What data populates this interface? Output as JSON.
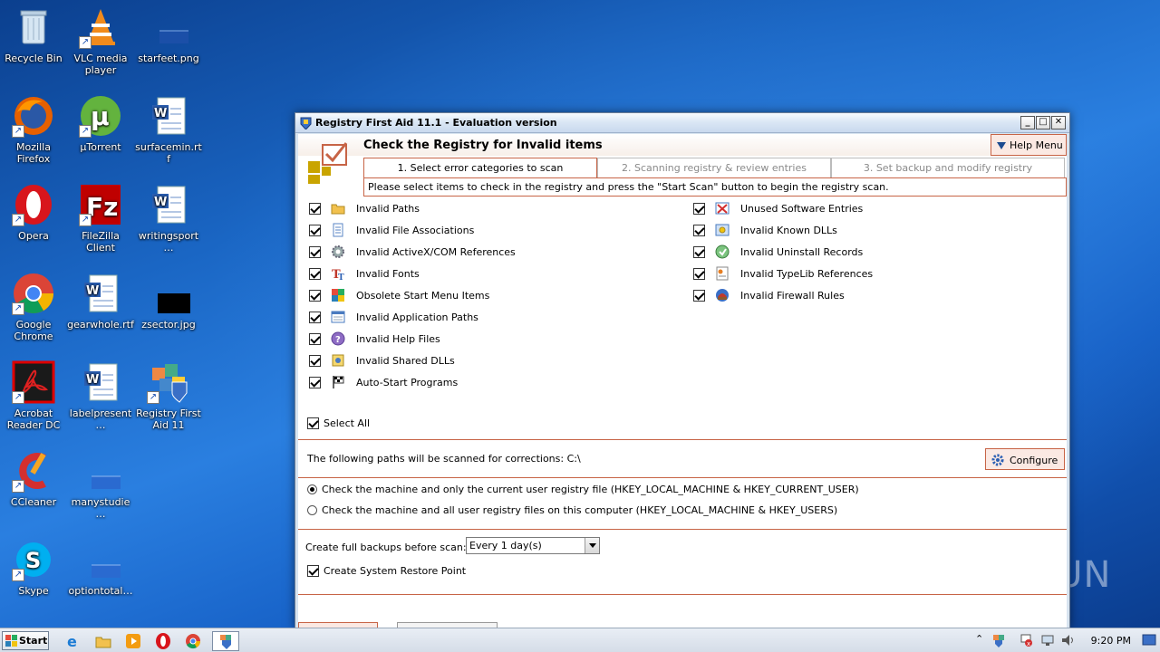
{
  "desktop": {
    "icons": [
      {
        "label": "Recycle Bin"
      },
      {
        "label": "VLC media player"
      },
      {
        "label": "starfeet.png"
      },
      {
        "label": "Mozilla Firefox"
      },
      {
        "label": "µTorrent"
      },
      {
        "label": "surfacemin.rtf"
      },
      {
        "label": "Opera"
      },
      {
        "label": "FileZilla Client"
      },
      {
        "label": "writingsport…"
      },
      {
        "label": "Google Chrome"
      },
      {
        "label": "gearwhole.rtf"
      },
      {
        "label": "zsector.jpg"
      },
      {
        "label": "Acrobat Reader DC"
      },
      {
        "label": "labelpresent…"
      },
      {
        "label": "Registry First Aid 11"
      },
      {
        "label": "CCleaner"
      },
      {
        "label": "manystudie…"
      },
      {
        "label": "Skype"
      },
      {
        "label": "optiontotal…"
      }
    ]
  },
  "window": {
    "title": "Registry First Aid 11.1 - Evaluation version",
    "controls": {
      "minimize": "_",
      "maximize": "□",
      "close": "✕"
    },
    "page_title": "Check the Registry for Invalid items",
    "help_menu": "Help Menu",
    "tabs": [
      {
        "label": "1. Select error categories to scan"
      },
      {
        "label": "2. Scanning registry & review entries"
      },
      {
        "label": "3. Set backup and modify registry"
      }
    ],
    "tab_info": "Please select items to check in the registry and press the \"Start Scan\" button to begin the registry scan.",
    "left_items": [
      {
        "label": "Invalid Paths",
        "icon": "folder-icon"
      },
      {
        "label": "Invalid File Associations",
        "icon": "document-icon"
      },
      {
        "label": "Invalid ActiveX/COM References",
        "icon": "gear-icon"
      },
      {
        "label": "Invalid Fonts",
        "icon": "font-icon"
      },
      {
        "label": "Obsolete Start Menu Items",
        "icon": "start-menu-icon"
      },
      {
        "label": "Invalid Application Paths",
        "icon": "application-icon"
      },
      {
        "label": "Invalid Help Files",
        "icon": "help-icon"
      },
      {
        "label": "Invalid Shared DLLs",
        "icon": "dll-icon"
      },
      {
        "label": "Auto-Start Programs",
        "icon": "flag-icon"
      }
    ],
    "right_items": [
      {
        "label": "Unused Software Entries",
        "icon": "unused-software-icon"
      },
      {
        "label": "Invalid Known DLLs",
        "icon": "known-dll-icon"
      },
      {
        "label": "Invalid Uninstall Records",
        "icon": "uninstall-icon"
      },
      {
        "label": "Invalid TypeLib References",
        "icon": "typelib-icon"
      },
      {
        "label": "Invalid Firewall Rules",
        "icon": "firewall-icon"
      }
    ],
    "select_all": "Select All",
    "paths_text": "The following paths will be scanned for corrections: C:\\",
    "configure": "Configure",
    "radio_options": [
      {
        "label": "Check the machine and only the current user registry file (HKEY_LOCAL_MACHINE & HKEY_CURRENT_USER)",
        "selected": true
      },
      {
        "label": "Check the machine and all user registry files on this computer (HKEY_LOCAL_MACHINE & HKEY_USERS)",
        "selected": false
      }
    ],
    "backup_label": "Create full backups before scan:",
    "backup_value": "Every 1 day(s)",
    "restore_point": "Create System Restore Point"
  },
  "taskbar": {
    "start": "Start",
    "clock": "9:20 PM"
  },
  "watermark": "ANY  RUN",
  "colors": {
    "accent": "#c76446",
    "title_blue": "#1c4a8f"
  }
}
